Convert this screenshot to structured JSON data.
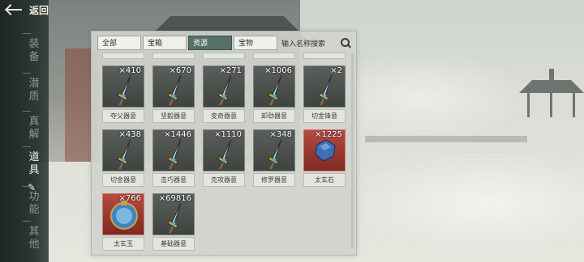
{
  "nav": {
    "back_label": "返回",
    "tabs": [
      {
        "label": "装备",
        "active": false
      },
      {
        "label": "潜质",
        "active": false
      },
      {
        "label": "真解",
        "active": false
      },
      {
        "label": "道具",
        "active": true
      },
      {
        "label": "功能",
        "active": false
      },
      {
        "label": "其他",
        "active": false
      }
    ]
  },
  "filters": {
    "tabs": [
      {
        "label": "全部",
        "active": false
      },
      {
        "label": "宝箱",
        "active": false
      },
      {
        "label": "资源",
        "active": true
      },
      {
        "label": "宝物",
        "active": false
      }
    ],
    "search_placeholder": "输入名称搜索"
  },
  "items": [
    {
      "name": "夺父器意",
      "count": "×410",
      "icon": "dagger-icon",
      "rarity": "normal"
    },
    {
      "name": "坚毅器意",
      "count": "×670",
      "icon": "dagger-icon",
      "rarity": "normal"
    },
    {
      "name": "变奇器意",
      "count": "×271",
      "icon": "dagger-icon",
      "rarity": "normal"
    },
    {
      "name": "卸劲器意",
      "count": "×1006",
      "icon": "dagger-icon",
      "rarity": "normal"
    },
    {
      "name": "切金锋意",
      "count": "×2",
      "icon": "dagger-icon",
      "rarity": "normal"
    },
    {
      "name": "切金器意",
      "count": "×438",
      "icon": "dagger-icon",
      "rarity": "normal"
    },
    {
      "name": "击巧器意",
      "count": "×1446",
      "icon": "dagger-icon",
      "rarity": "normal"
    },
    {
      "name": "克攻器意",
      "count": "×1110",
      "icon": "dagger-icon",
      "rarity": "normal"
    },
    {
      "name": "修罗器意",
      "count": "×348",
      "icon": "dagger-icon",
      "rarity": "normal"
    },
    {
      "name": "太玄石",
      "count": "×1225",
      "icon": "blue-stone-icon",
      "rarity": "red"
    },
    {
      "name": "太玄玉",
      "count": "×766",
      "icon": "jade-icon",
      "rarity": "red"
    },
    {
      "name": "基础器意",
      "count": "×69816",
      "icon": "dagger-icon",
      "rarity": "normal"
    }
  ],
  "colors": {
    "active_tab": "#57706a",
    "red_slot": "#b54b40",
    "panel": "#d0d3cd"
  }
}
